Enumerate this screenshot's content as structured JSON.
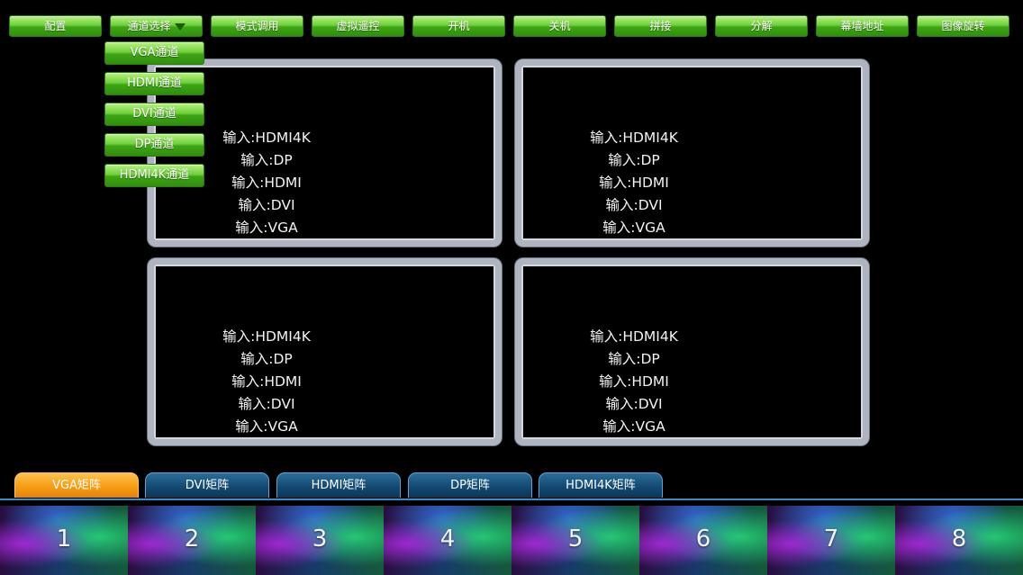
{
  "toolbar": {
    "items": [
      {
        "label": "配置"
      },
      {
        "label": "通道选择"
      },
      {
        "label": "模式调用"
      },
      {
        "label": "虚拟遥控"
      },
      {
        "label": "开机"
      },
      {
        "label": "关机"
      },
      {
        "label": "拼接"
      },
      {
        "label": "分解"
      },
      {
        "label": "幕墙地址"
      },
      {
        "label": "图像旋转"
      }
    ],
    "dropdown_caret_icon": "triangle-down-icon"
  },
  "channel_dropdown": {
    "items": [
      {
        "label": "VGA通道"
      },
      {
        "label": "HDMI通道"
      },
      {
        "label": "DVI通道"
      },
      {
        "label": "DP通道"
      },
      {
        "label": "HDMI4K通道"
      }
    ]
  },
  "screens": [
    {
      "lines": [
        "输入:HDMI4K",
        "输入:DP",
        "输入:HDMI",
        "输入:DVI",
        "输入:VGA"
      ]
    },
    {
      "lines": [
        "输入:HDMI4K",
        "输入:DP",
        "输入:HDMI",
        "输入:DVI",
        "输入:VGA"
      ]
    },
    {
      "lines": [
        "输入:HDMI4K",
        "输入:DP",
        "输入:HDMI",
        "输入:DVI",
        "输入:VGA"
      ]
    },
    {
      "lines": [
        "输入:HDMI4K",
        "输入:DP",
        "输入:HDMI",
        "输入:DVI",
        "输入:VGA"
      ]
    }
  ],
  "matrix_tabs": {
    "active_index": 0,
    "items": [
      {
        "label": "VGA矩阵"
      },
      {
        "label": "DVI矩阵"
      },
      {
        "label": "HDMI矩阵"
      },
      {
        "label": "DP矩阵"
      },
      {
        "label": "HDMI4K矩阵"
      }
    ]
  },
  "channels": {
    "items": [
      {
        "label": "1"
      },
      {
        "label": "2"
      },
      {
        "label": "3"
      },
      {
        "label": "4"
      },
      {
        "label": "5"
      },
      {
        "label": "6"
      },
      {
        "label": "7"
      },
      {
        "label": "8"
      }
    ]
  },
  "colors": {
    "toolbar_green": "#4db81f",
    "tab_blue": "#124a72",
    "tab_active_orange": "#f59a12",
    "panel_frame": "#aeb5c0"
  }
}
